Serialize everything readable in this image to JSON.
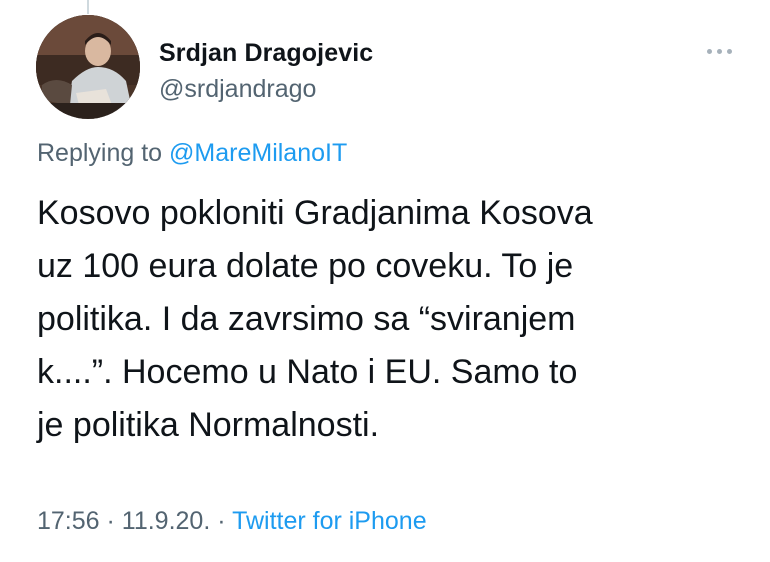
{
  "tweet": {
    "author": {
      "display_name": "Srdjan Dragojevic",
      "handle": "@srdjandrago"
    },
    "more_icon": "more-horizontal-icon",
    "reply": {
      "prefix": "Replying to",
      "mention": "@MareMilanoIT"
    },
    "text_lines": [
      "Kosovo pokloniti Gradjanima Kosova",
      "uz 100 eura dolate po coveku. To je",
      "politika. I da zavrsimo sa “sviranjem",
      "k....”. Hocemo u Nato i EU. Samo to",
      "je politika Normalnosti."
    ],
    "meta": {
      "time": "17:56",
      "sep1": " · ",
      "date": "11.9.20.",
      "sep2": " · ",
      "source": "Twitter for iPhone"
    }
  },
  "colors": {
    "text": "#0f1419",
    "secondary": "#536471",
    "link": "#1d9bf0"
  }
}
